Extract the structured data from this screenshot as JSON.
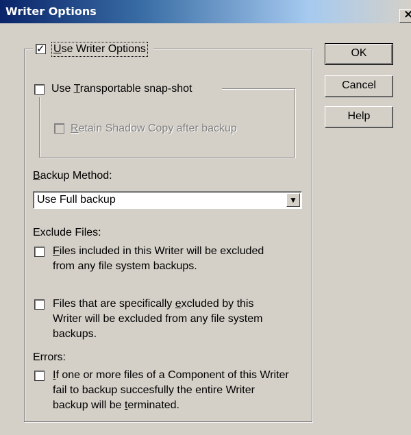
{
  "window": {
    "title": "Writer Options",
    "close_glyph": "×"
  },
  "use_writer_options": {
    "checked": true,
    "label_mnemonic": "U",
    "label_rest": "se Writer Options"
  },
  "transportable": {
    "checked": false,
    "label_pre": "Use ",
    "label_mnemonic": "T",
    "label_rest": "ransportable snap-shot",
    "retain": {
      "checked": false,
      "enabled": false,
      "label_mnemonic": "R",
      "label_rest": "etain Shadow Copy after backup"
    }
  },
  "backup_method": {
    "label_mnemonic": "B",
    "label_rest": "ackup Method:",
    "selected": "Use Full backup",
    "arrow_icon": "▼"
  },
  "exclude_files": {
    "heading": "Exclude Files:",
    "option1": {
      "checked": false,
      "line1_mnemonic": "F",
      "line1_rest": "iles included in this Writer will be excluded",
      "line2": "from any file system backups."
    },
    "option2": {
      "checked": false,
      "line1_pre": "Files that are specifically ",
      "line1_mnemonic": "e",
      "line1_rest": "xcluded by this",
      "line2": "Writer will be excluded from any file system",
      "line3": "backups."
    }
  },
  "errors": {
    "heading": "Errors:",
    "option": {
      "checked": false,
      "line1_mnemonic": "I",
      "line1_rest": "f one or more files of a Component of this Writer",
      "line2": "fail to backup succesfully the entire Writer",
      "line3_pre": "backup will be ",
      "line3_mnemonic": "t",
      "line3_rest": "erminated."
    }
  },
  "buttons": {
    "ok": "OK",
    "cancel": "Cancel",
    "help": "Help"
  }
}
